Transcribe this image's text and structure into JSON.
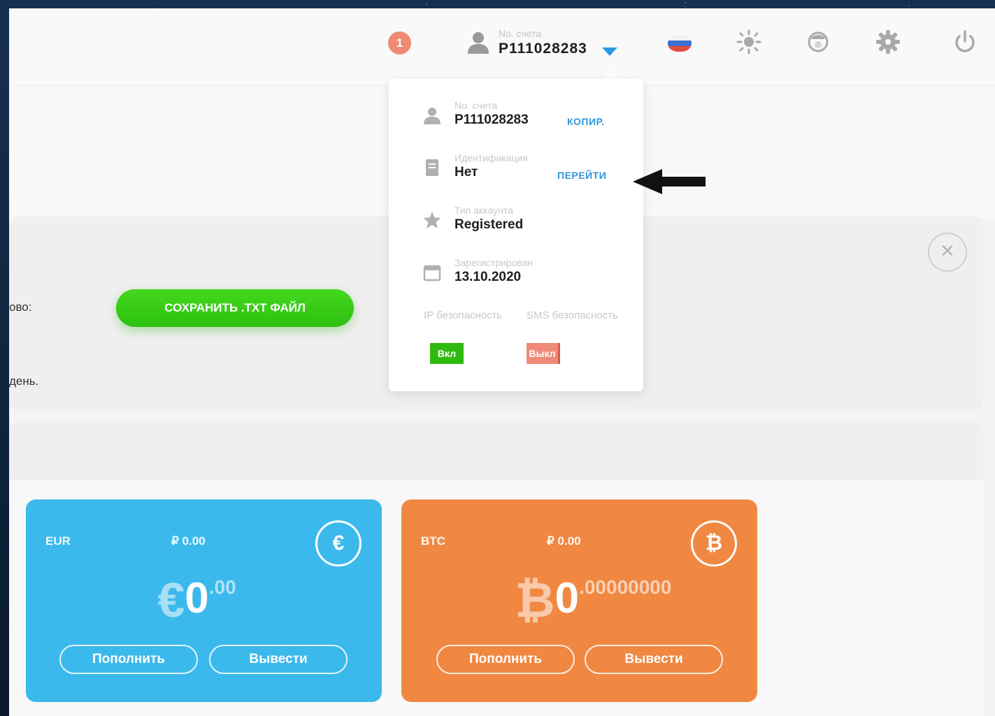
{
  "header": {
    "notification_count": "1",
    "account_label": "No. счета",
    "account_number": "P111028283",
    "icons": [
      "user-icon",
      "chevron-down-icon",
      "russia-flag-icon",
      "sun-icon",
      "support-icon",
      "gear-icon",
      "power-icon"
    ]
  },
  "notice": {
    "text_line1": "ово:",
    "text_line2": "день.",
    "save_button_label": "СОХРАНИТЬ .TXT ФАЙЛ",
    "close_symbol": "✕"
  },
  "account_dropdown": {
    "account": {
      "label": "No. счета",
      "value": "P111028283",
      "action": "КОПИР."
    },
    "identification": {
      "label": "Идентификация",
      "value": "Нет",
      "action": "ПЕРЕЙТИ"
    },
    "account_type": {
      "label": "Тип аккаунта",
      "value": "Registered"
    },
    "registered": {
      "label": "Зарегистрирован",
      "value": "13.10.2020"
    },
    "ip_security": {
      "label": "IP безопасность",
      "toggle": "Вкл",
      "state": "on"
    },
    "sms_security": {
      "label": "SMS безопасность",
      "toggle": "Выкл",
      "state": "off"
    }
  },
  "wallets": [
    {
      "code": "EUR",
      "rub_equivalent": "₽ 0.00",
      "symbol": "€",
      "integer": "0",
      "fraction": ".00",
      "deposit_label": "Пополнить",
      "withdraw_label": "Вывести",
      "color": "#3bb9ec"
    },
    {
      "code": "BTC",
      "rub_equivalent": "₽ 0.00",
      "symbol": "₿",
      "integer": "0",
      "fraction": ".00000000",
      "deposit_label": "Пополнить",
      "withdraw_label": "Вывести",
      "color": "#f08842"
    }
  ],
  "colors": {
    "accent_blue": "#2b9be6",
    "success_green": "#2fba10",
    "notification_red": "#ef8a72"
  }
}
